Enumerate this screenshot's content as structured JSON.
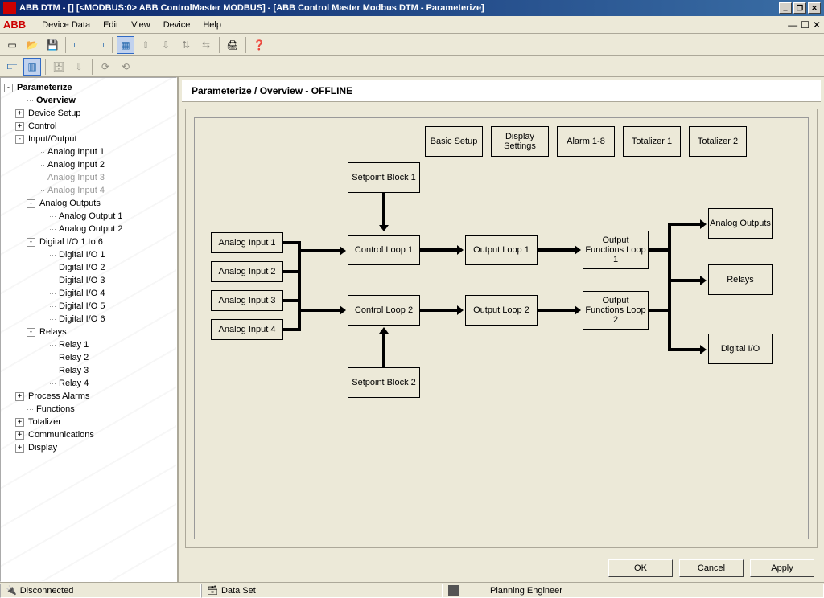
{
  "title": "ABB DTM - []  [<MODBUS:0> ABB ControlMaster MODBUS]  - [ABB Control Master Modbus DTM - Parameterize]",
  "brand": "ABB",
  "menu": [
    "Device Data",
    "Edit",
    "View",
    "Device",
    "Help"
  ],
  "tree": [
    {
      "label": "Parameterize",
      "level": 0,
      "toggle": "-",
      "bold": true
    },
    {
      "label": "Overview",
      "level": 1,
      "toggle": "",
      "bold": true
    },
    {
      "label": "Device Setup",
      "level": 1,
      "toggle": "+"
    },
    {
      "label": "Control",
      "level": 1,
      "toggle": "+"
    },
    {
      "label": "Input/Output",
      "level": 1,
      "toggle": "-"
    },
    {
      "label": "Analog Input 1",
      "level": 2,
      "toggle": ""
    },
    {
      "label": "Analog Input 2",
      "level": 2,
      "toggle": ""
    },
    {
      "label": "Analog Input 3",
      "level": 2,
      "toggle": "",
      "disabled": true
    },
    {
      "label": "Analog Input 4",
      "level": 2,
      "toggle": "",
      "disabled": true
    },
    {
      "label": "Analog Outputs",
      "level": 2,
      "toggle": "-"
    },
    {
      "label": "Analog Output 1",
      "level": 3,
      "toggle": ""
    },
    {
      "label": "Analog Output 2",
      "level": 3,
      "toggle": ""
    },
    {
      "label": "Digital I/O 1 to 6",
      "level": 2,
      "toggle": "-"
    },
    {
      "label": "Digital I/O 1",
      "level": 3,
      "toggle": ""
    },
    {
      "label": "Digital I/O 2",
      "level": 3,
      "toggle": ""
    },
    {
      "label": "Digital I/O 3",
      "level": 3,
      "toggle": ""
    },
    {
      "label": "Digital I/O 4",
      "level": 3,
      "toggle": ""
    },
    {
      "label": "Digital I/O 5",
      "level": 3,
      "toggle": ""
    },
    {
      "label": "Digital I/O 6",
      "level": 3,
      "toggle": ""
    },
    {
      "label": "Relays",
      "level": 2,
      "toggle": "-"
    },
    {
      "label": "Relay 1",
      "level": 3,
      "toggle": ""
    },
    {
      "label": "Relay 2",
      "level": 3,
      "toggle": ""
    },
    {
      "label": "Relay 3",
      "level": 3,
      "toggle": ""
    },
    {
      "label": "Relay 4",
      "level": 3,
      "toggle": ""
    },
    {
      "label": "Process Alarms",
      "level": 1,
      "toggle": "+"
    },
    {
      "label": "Functions",
      "level": 1,
      "toggle": ""
    },
    {
      "label": "Totalizer",
      "level": 1,
      "toggle": "+"
    },
    {
      "label": "Communications",
      "level": 1,
      "toggle": "+"
    },
    {
      "label": "Display",
      "level": 1,
      "toggle": "+"
    }
  ],
  "breadcrumb": "Parameterize / Overview - OFFLINE",
  "top_buttons": [
    "Basic Setup",
    "Display Settings",
    "Alarm 1-8",
    "Totalizer 1",
    "Totalizer 2"
  ],
  "diagram": {
    "setpoint1": "Setpoint Block 1",
    "setpoint2": "Setpoint Block 2",
    "ain1": "Analog Input 1",
    "ain2": "Analog Input 2",
    "ain3": "Analog Input 3",
    "ain4": "Analog Input 4",
    "cl1": "Control Loop 1",
    "cl2": "Control Loop 2",
    "ol1": "Output Loop 1",
    "ol2": "Output Loop 2",
    "of1": "Output Functions Loop 1",
    "of2": "Output Functions Loop 2",
    "aout": "Analog Outputs",
    "relays": "Relays",
    "dio": "Digital I/O"
  },
  "buttons": {
    "ok": "OK",
    "cancel": "Cancel",
    "apply": "Apply"
  },
  "status": {
    "connection": "Disconnected",
    "dataset": "Data Set",
    "role": "Planning Engineer"
  }
}
